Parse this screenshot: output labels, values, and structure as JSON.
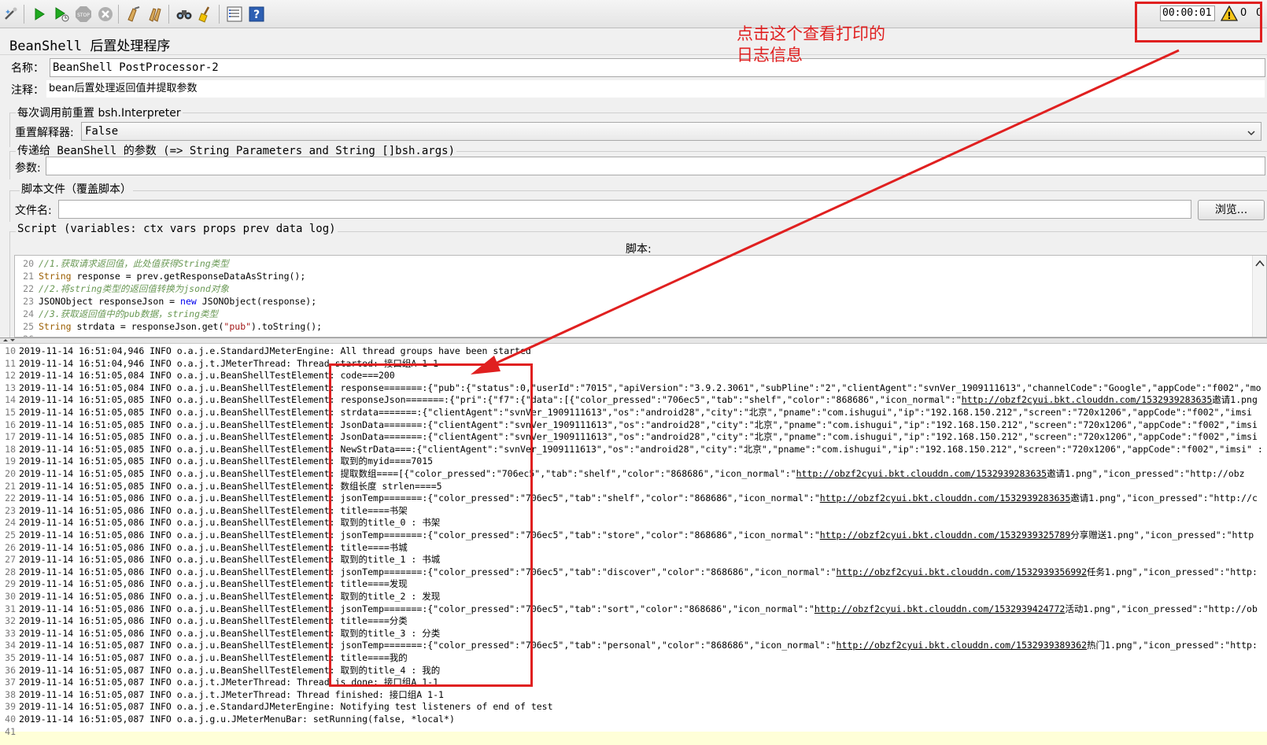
{
  "toolbar": {
    "timer": "00:00:01",
    "warn_count": "0",
    "thread_count": "0"
  },
  "panel": {
    "title": "BeanShell 后置处理程序",
    "name_label": "名称：",
    "name_value": "BeanShell PostProcessor-2",
    "comment_label": "注释：",
    "comment_value": "bean后置处理返回值并提取参数",
    "reset_group_title": "每次调用前重置 bsh.Interpreter",
    "reset_label": "重置解释器:",
    "reset_value": "False",
    "params_group_title": "传递给 BeanShell 的参数 (=> String Parameters and String []bsh.args)",
    "params_label": "参数:",
    "params_value": "",
    "file_group_title": "脚本文件（覆盖脚本）",
    "file_label": "文件名:",
    "file_value": "",
    "browse_label": "浏览...",
    "script_group_title": "Script (variables: ctx vars props prev data log)",
    "script_label": "脚本:"
  },
  "code": [
    {
      "ln": "20",
      "text": "//1.获取请求返回值，此处值获得String类型",
      "kind": "comment"
    },
    {
      "ln": "21",
      "text": "String response = prev.getResponseDataAsString();",
      "kind": "code"
    },
    {
      "ln": "22",
      "text": "//2.将string类型的返回值转换为jsond对象",
      "kind": "comment"
    },
    {
      "ln": "23",
      "text": "JSONObject responseJson = new JSONObject(response);",
      "kind": "code"
    },
    {
      "ln": "24",
      "text": "//3.获取返回值中的pub数据，string类型",
      "kind": "comment"
    },
    {
      "ln": "25",
      "text": "String strdata = responseJson.get(\"pub\").toString();",
      "kind": "code"
    },
    {
      "ln": "26",
      "text": "",
      "kind": "code"
    }
  ],
  "log": [
    {
      "ln": "10",
      "text": "2019-11-14 16:51:04,946 INFO o.a.j.e.StandardJMeterEngine: All thread groups have been started"
    },
    {
      "ln": "11",
      "text": "2019-11-14 16:51:04,946 INFO o.a.j.t.JMeterThread: Thread started: 接口组A 1-1"
    },
    {
      "ln": "12",
      "text": "2019-11-14 16:51:05,084 INFO o.a.j.u.BeanShellTestElement: code===200"
    },
    {
      "ln": "13",
      "text": "2019-11-14 16:51:05,084 INFO o.a.j.u.BeanShellTestElement: response=======:{\"pub\":{\"status\":0,\"userId\":\"7015\",\"apiVersion\":\"3.9.2.3061\",\"subPline\":\"2\",\"clientAgent\":\"svnVer_1909111613\",\"channelCode\":\"Google\",\"appCode\":\"f002\",\"mo"
    },
    {
      "ln": "14",
      "text": "2019-11-14 16:51:05,085 INFO o.a.j.u.BeanShellTestElement: responseJson=======:{\"pri\":{\"f7\":{\"data\":[{\"color_pressed\":\"706ec5\",\"tab\":\"shelf\",\"color\":\"868686\",\"icon_normal\":\"",
      "link": "http://obzf2cyui.bkt.clouddn.com/1532939283635",
      "after": "邀请1.png"
    },
    {
      "ln": "15",
      "text": "2019-11-14 16:51:05,085 INFO o.a.j.u.BeanShellTestElement: strdata=======:{\"clientAgent\":\"svnVer_1909111613\",\"os\":\"android28\",\"city\":\"北京\",\"pname\":\"com.ishugui\",\"ip\":\"192.168.150.212\",\"screen\":\"720x1206\",\"appCode\":\"f002\",\"imsi"
    },
    {
      "ln": "16",
      "text": "2019-11-14 16:51:05,085 INFO o.a.j.u.BeanShellTestElement: JsonData=======:{\"clientAgent\":\"svnVer_1909111613\",\"os\":\"android28\",\"city\":\"北京\",\"pname\":\"com.ishugui\",\"ip\":\"192.168.150.212\",\"screen\":\"720x1206\",\"appCode\":\"f002\",\"imsi"
    },
    {
      "ln": "17",
      "text": "2019-11-14 16:51:05,085 INFO o.a.j.u.BeanShellTestElement: JsonData=======:{\"clientAgent\":\"svnVer_1909111613\",\"os\":\"android28\",\"city\":\"北京\",\"pname\":\"com.ishugui\",\"ip\":\"192.168.150.212\",\"screen\":\"720x1206\",\"appCode\":\"f002\",\"imsi"
    },
    {
      "ln": "18",
      "text": "2019-11-14 16:51:05,085 INFO o.a.j.u.BeanShellTestElement: NewStrData===:{\"clientAgent\":\"svnVer_1909111613\",\"os\":\"android28\",\"city\":\"北京\",\"pname\":\"com.ishugui\",\"ip\":\"192.168.150.212\",\"screen\":\"720x1206\",\"appCode\":\"f002\",\"imsi\" :"
    },
    {
      "ln": "19",
      "text": "2019-11-14 16:51:05,085 INFO o.a.j.u.BeanShellTestElement: 取到的myid====7015"
    },
    {
      "ln": "20",
      "text": "2019-11-14 16:51:05,085 INFO o.a.j.u.BeanShellTestElement: 提取数组====[{\"color_pressed\":\"706ec5\",\"tab\":\"shelf\",\"color\":\"868686\",\"icon_normal\":\"",
      "link": "http://obzf2cyui.bkt.clouddn.com/1532939283635",
      "after": "邀请1.png\",\"icon_pressed\":\"http://obz"
    },
    {
      "ln": "21",
      "text": "2019-11-14 16:51:05,085 INFO o.a.j.u.BeanShellTestElement: 数组长度 strlen====5"
    },
    {
      "ln": "22",
      "text": "2019-11-14 16:51:05,086 INFO o.a.j.u.BeanShellTestElement: jsonTemp=======:{\"color_pressed\":\"706ec5\",\"tab\":\"shelf\",\"color\":\"868686\",\"icon_normal\":\"",
      "link": "http://obzf2cyui.bkt.clouddn.com/1532939283635",
      "after": "邀请1.png\",\"icon_pressed\":\"http://c"
    },
    {
      "ln": "23",
      "text": "2019-11-14 16:51:05,086 INFO o.a.j.u.BeanShellTestElement: title====书架"
    },
    {
      "ln": "24",
      "text": "2019-11-14 16:51:05,086 INFO o.a.j.u.BeanShellTestElement: 取到的title_0 : 书架"
    },
    {
      "ln": "25",
      "text": "2019-11-14 16:51:05,086 INFO o.a.j.u.BeanShellTestElement: jsonTemp=======:{\"color_pressed\":\"706ec5\",\"tab\":\"store\",\"color\":\"868686\",\"icon_normal\":\"",
      "link": "http://obzf2cyui.bkt.clouddn.com/1532939325789",
      "after": "分享赠送1.png\",\"icon_pressed\":\"http"
    },
    {
      "ln": "26",
      "text": "2019-11-14 16:51:05,086 INFO o.a.j.u.BeanShellTestElement: title====书城"
    },
    {
      "ln": "27",
      "text": "2019-11-14 16:51:05,086 INFO o.a.j.u.BeanShellTestElement: 取到的title_1 : 书城"
    },
    {
      "ln": "28",
      "text": "2019-11-14 16:51:05,086 INFO o.a.j.u.BeanShellTestElement: jsonTemp=======:{\"color_pressed\":\"706ec5\",\"tab\":\"discover\",\"color\":\"868686\",\"icon_normal\":\"",
      "link": "http://obzf2cyui.bkt.clouddn.com/1532939356992",
      "after": "任务1.png\",\"icon_pressed\":\"http:"
    },
    {
      "ln": "29",
      "text": "2019-11-14 16:51:05,086 INFO o.a.j.u.BeanShellTestElement: title====发现"
    },
    {
      "ln": "30",
      "text": "2019-11-14 16:51:05,086 INFO o.a.j.u.BeanShellTestElement: 取到的title_2 : 发现"
    },
    {
      "ln": "31",
      "text": "2019-11-14 16:51:05,086 INFO o.a.j.u.BeanShellTestElement: jsonTemp=======:{\"color_pressed\":\"706ec5\",\"tab\":\"sort\",\"color\":\"868686\",\"icon_normal\":\"",
      "link": "http://obzf2cyui.bkt.clouddn.com/1532939424772",
      "after": "活动1.png\",\"icon_pressed\":\"http://ob"
    },
    {
      "ln": "32",
      "text": "2019-11-14 16:51:05,086 INFO o.a.j.u.BeanShellTestElement: title====分类"
    },
    {
      "ln": "33",
      "text": "2019-11-14 16:51:05,086 INFO o.a.j.u.BeanShellTestElement: 取到的title_3 : 分类"
    },
    {
      "ln": "34",
      "text": "2019-11-14 16:51:05,087 INFO o.a.j.u.BeanShellTestElement: jsonTemp=======:{\"color_pressed\":\"706ec5\",\"tab\":\"personal\",\"color\":\"868686\",\"icon_normal\":\"",
      "link": "http://obzf2cyui.bkt.clouddn.com/1532939389362",
      "after": "热门1.png\",\"icon_pressed\":\"http:"
    },
    {
      "ln": "35",
      "text": "2019-11-14 16:51:05,087 INFO o.a.j.u.BeanShellTestElement: title====我的"
    },
    {
      "ln": "36",
      "text": "2019-11-14 16:51:05,087 INFO o.a.j.u.BeanShellTestElement: 取到的title_4 : 我的"
    },
    {
      "ln": "37",
      "text": "2019-11-14 16:51:05,087 INFO o.a.j.t.JMeterThread: Thread is done: 接口组A 1-1"
    },
    {
      "ln": "38",
      "text": "2019-11-14 16:51:05,087 INFO o.a.j.t.JMeterThread: Thread finished: 接口组A 1-1"
    },
    {
      "ln": "39",
      "text": "2019-11-14 16:51:05,087 INFO o.a.j.e.StandardJMeterEngine: Notifying test listeners of end of test"
    },
    {
      "ln": "40",
      "text": "2019-11-14 16:51:05,087 INFO o.a.j.g.u.JMeterMenuBar: setRunning(false, *local*)"
    },
    {
      "ln": "41",
      "text": ""
    }
  ],
  "annotation": {
    "text_line1": "点击这个查看打印的",
    "text_line2": "日志信息",
    "color": "#e02020"
  }
}
